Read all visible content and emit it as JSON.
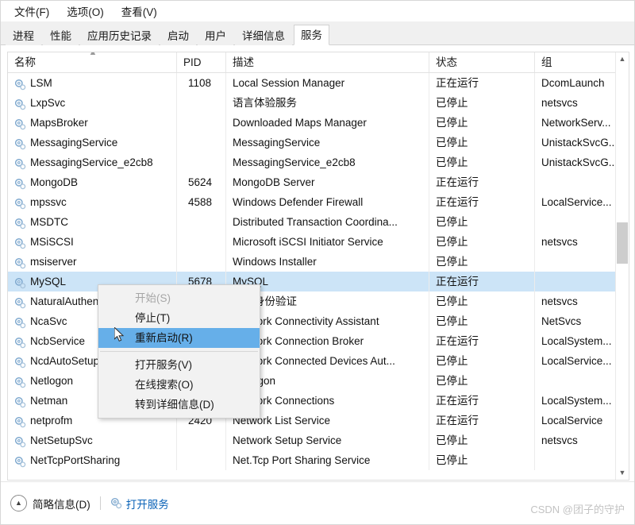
{
  "window": {
    "menus": [
      {
        "label": "文件(F)",
        "name": "menu-file"
      },
      {
        "label": "选项(O)",
        "name": "menu-options"
      },
      {
        "label": "查看(V)",
        "name": "menu-view"
      }
    ],
    "tabs": [
      {
        "label": "进程",
        "active": false
      },
      {
        "label": "性能",
        "active": false
      },
      {
        "label": "应用历史记录",
        "active": false
      },
      {
        "label": "启动",
        "active": false
      },
      {
        "label": "用户",
        "active": false
      },
      {
        "label": "详细信息",
        "active": false
      },
      {
        "label": "服务",
        "active": true
      }
    ]
  },
  "table": {
    "columns": [
      {
        "label": "名称",
        "key": "name",
        "sorted": "asc"
      },
      {
        "label": "PID",
        "key": "pid",
        "sorted": ""
      },
      {
        "label": "描述",
        "key": "description",
        "sorted": ""
      },
      {
        "label": "状态",
        "key": "state",
        "sorted": ""
      },
      {
        "label": "组",
        "key": "group",
        "sorted": ""
      }
    ],
    "status_running": "正在运行",
    "status_stopped": "已停止",
    "rows": [
      {
        "name": "LSM",
        "pid": "1108",
        "description": "Local Session Manager",
        "state": "正在运行",
        "group": "DcomLaunch",
        "selected": false
      },
      {
        "name": "LxpSvc",
        "pid": "",
        "description": "语言体验服务",
        "state": "已停止",
        "group": "netsvcs",
        "selected": false
      },
      {
        "name": "MapsBroker",
        "pid": "",
        "description": "Downloaded Maps Manager",
        "state": "已停止",
        "group": "NetworkServ...",
        "selected": false
      },
      {
        "name": "MessagingService",
        "pid": "",
        "description": "MessagingService",
        "state": "已停止",
        "group": "UnistackSvcG...",
        "selected": false
      },
      {
        "name": "MessagingService_e2cb8",
        "pid": "",
        "description": "MessagingService_e2cb8",
        "state": "已停止",
        "group": "UnistackSvcG...",
        "selected": false
      },
      {
        "name": "MongoDB",
        "pid": "5624",
        "description": "MongoDB Server",
        "state": "正在运行",
        "group": "",
        "selected": false
      },
      {
        "name": "mpssvc",
        "pid": "4588",
        "description": "Windows Defender Firewall",
        "state": "正在运行",
        "group": "LocalService...",
        "selected": false
      },
      {
        "name": "MSDTC",
        "pid": "",
        "description": "Distributed Transaction Coordina...",
        "state": "已停止",
        "group": "",
        "selected": false
      },
      {
        "name": "MSiSCSI",
        "pid": "",
        "description": "Microsoft iSCSI Initiator Service",
        "state": "已停止",
        "group": "netsvcs",
        "selected": false
      },
      {
        "name": "msiserver",
        "pid": "",
        "description": "Windows Installer",
        "state": "已停止",
        "group": "",
        "selected": false
      },
      {
        "name": "MySQL",
        "pid": "5678",
        "description": "MySQL",
        "state": "正在运行",
        "group": "",
        "selected": true
      },
      {
        "name": "NaturalAuthentication",
        "pid": "",
        "description": "自然身份验证",
        "state": "已停止",
        "group": "netsvcs",
        "selected": false
      },
      {
        "name": "NcaSvc",
        "pid": "",
        "description": "Network Connectivity Assistant",
        "state": "已停止",
        "group": "NetSvcs",
        "selected": false
      },
      {
        "name": "NcbService",
        "pid": "",
        "description": "Network Connection Broker",
        "state": "正在运行",
        "group": "LocalSystem...",
        "selected": false
      },
      {
        "name": "NcdAutoSetup",
        "pid": "",
        "description": "Network Connected Devices Aut...",
        "state": "已停止",
        "group": "LocalService...",
        "selected": false
      },
      {
        "name": "Netlogon",
        "pid": "",
        "description": "Netlogon",
        "state": "已停止",
        "group": "",
        "selected": false
      },
      {
        "name": "Netman",
        "pid": "",
        "description": "Network Connections",
        "state": "正在运行",
        "group": "LocalSystem...",
        "selected": false
      },
      {
        "name": "netprofm",
        "pid": "2420",
        "description": "Network List Service",
        "state": "正在运行",
        "group": "LocalService",
        "selected": false
      },
      {
        "name": "NetSetupSvc",
        "pid": "",
        "description": "Network Setup Service",
        "state": "已停止",
        "group": "netsvcs",
        "selected": false
      },
      {
        "name": "NetTcpPortSharing",
        "pid": "",
        "description": "Net.Tcp Port Sharing Service",
        "state": "已停止",
        "group": "",
        "selected": false
      }
    ]
  },
  "context_menu": {
    "items": [
      {
        "label": "开始(S)",
        "state": "disabled",
        "name": "ctx-start"
      },
      {
        "label": "停止(T)",
        "state": "normal",
        "name": "ctx-stop"
      },
      {
        "label": "重新启动(R)",
        "state": "highlight",
        "name": "ctx-restart"
      },
      {
        "label": "---",
        "state": "separator",
        "name": "ctx-separator"
      },
      {
        "label": "打开服务(V)",
        "state": "normal",
        "name": "ctx-open-services"
      },
      {
        "label": "在线搜索(O)",
        "state": "normal",
        "name": "ctx-search-online"
      },
      {
        "label": "转到详细信息(D)",
        "state": "normal",
        "name": "ctx-go-to-details"
      }
    ]
  },
  "statusbar": {
    "collapse_label": "简略信息(D)",
    "open_services_label": "打开服务"
  },
  "watermark": "CSDN @团子的守护",
  "colors": {
    "selection": "#cce4f7",
    "menu_highlight": "#66afe9",
    "link": "#0b63b8",
    "tab_strip": "#f0f0f0"
  }
}
